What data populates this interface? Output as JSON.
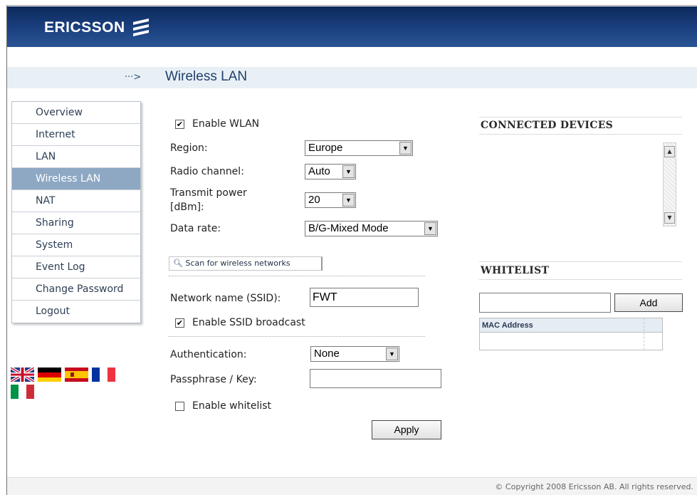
{
  "header": {
    "brand": "ERICSSON"
  },
  "title_bar": {
    "arrow": "···>",
    "title": "Wireless LAN"
  },
  "sidebar": {
    "items": [
      {
        "label": "Overview"
      },
      {
        "label": "Internet"
      },
      {
        "label": "LAN"
      },
      {
        "label": "Wireless LAN",
        "active": true
      },
      {
        "label": "NAT"
      },
      {
        "label": "Sharing"
      },
      {
        "label": "System"
      },
      {
        "label": "Event Log"
      },
      {
        "label": "Change Password"
      },
      {
        "label": "Logout"
      }
    ]
  },
  "languages": [
    "english-flag-icon",
    "german-flag-icon",
    "spanish-flag-icon",
    "french-flag-icon",
    "italian-flag-icon"
  ],
  "form": {
    "enable_wlan": {
      "label": "Enable WLAN",
      "checked": true
    },
    "region": {
      "label": "Region:",
      "value": "Europe"
    },
    "radio_channel": {
      "label": "Radio channel:",
      "value": "Auto"
    },
    "transmit_power": {
      "label_line1": "Transmit power",
      "label_line2": "[dBm]:",
      "value": "20"
    },
    "data_rate": {
      "label": "Data rate:",
      "value": "B/G-Mixed Mode"
    },
    "scan_button": "Scan for wireless networks",
    "ssid": {
      "label": "Network name (SSID):",
      "value": "FWT"
    },
    "enable_ssid_broadcast": {
      "label": "Enable SSID broadcast",
      "checked": true
    },
    "authentication": {
      "label": "Authentication:",
      "value": "None"
    },
    "passphrase": {
      "label": "Passphrase / Key:",
      "value": ""
    },
    "enable_whitelist": {
      "label": "Enable whitelist",
      "checked": false
    },
    "apply_button": "Apply"
  },
  "connected_devices": {
    "heading": "CONNECTED DEVICES"
  },
  "whitelist": {
    "heading": "WHITELIST",
    "input_value": "",
    "add_button": "Add",
    "column_header": "MAC Address"
  },
  "footer": {
    "copyright": "© Copyright 2008 Ericsson AB. All rights reserved."
  },
  "colors": {
    "header_dark": "#0d2a5c",
    "header_light": "#2a5594",
    "title_bar_bg": "#e9f0f5",
    "title_text": "#1f3f6e",
    "active_nav_bg": "#8ea8c4"
  }
}
